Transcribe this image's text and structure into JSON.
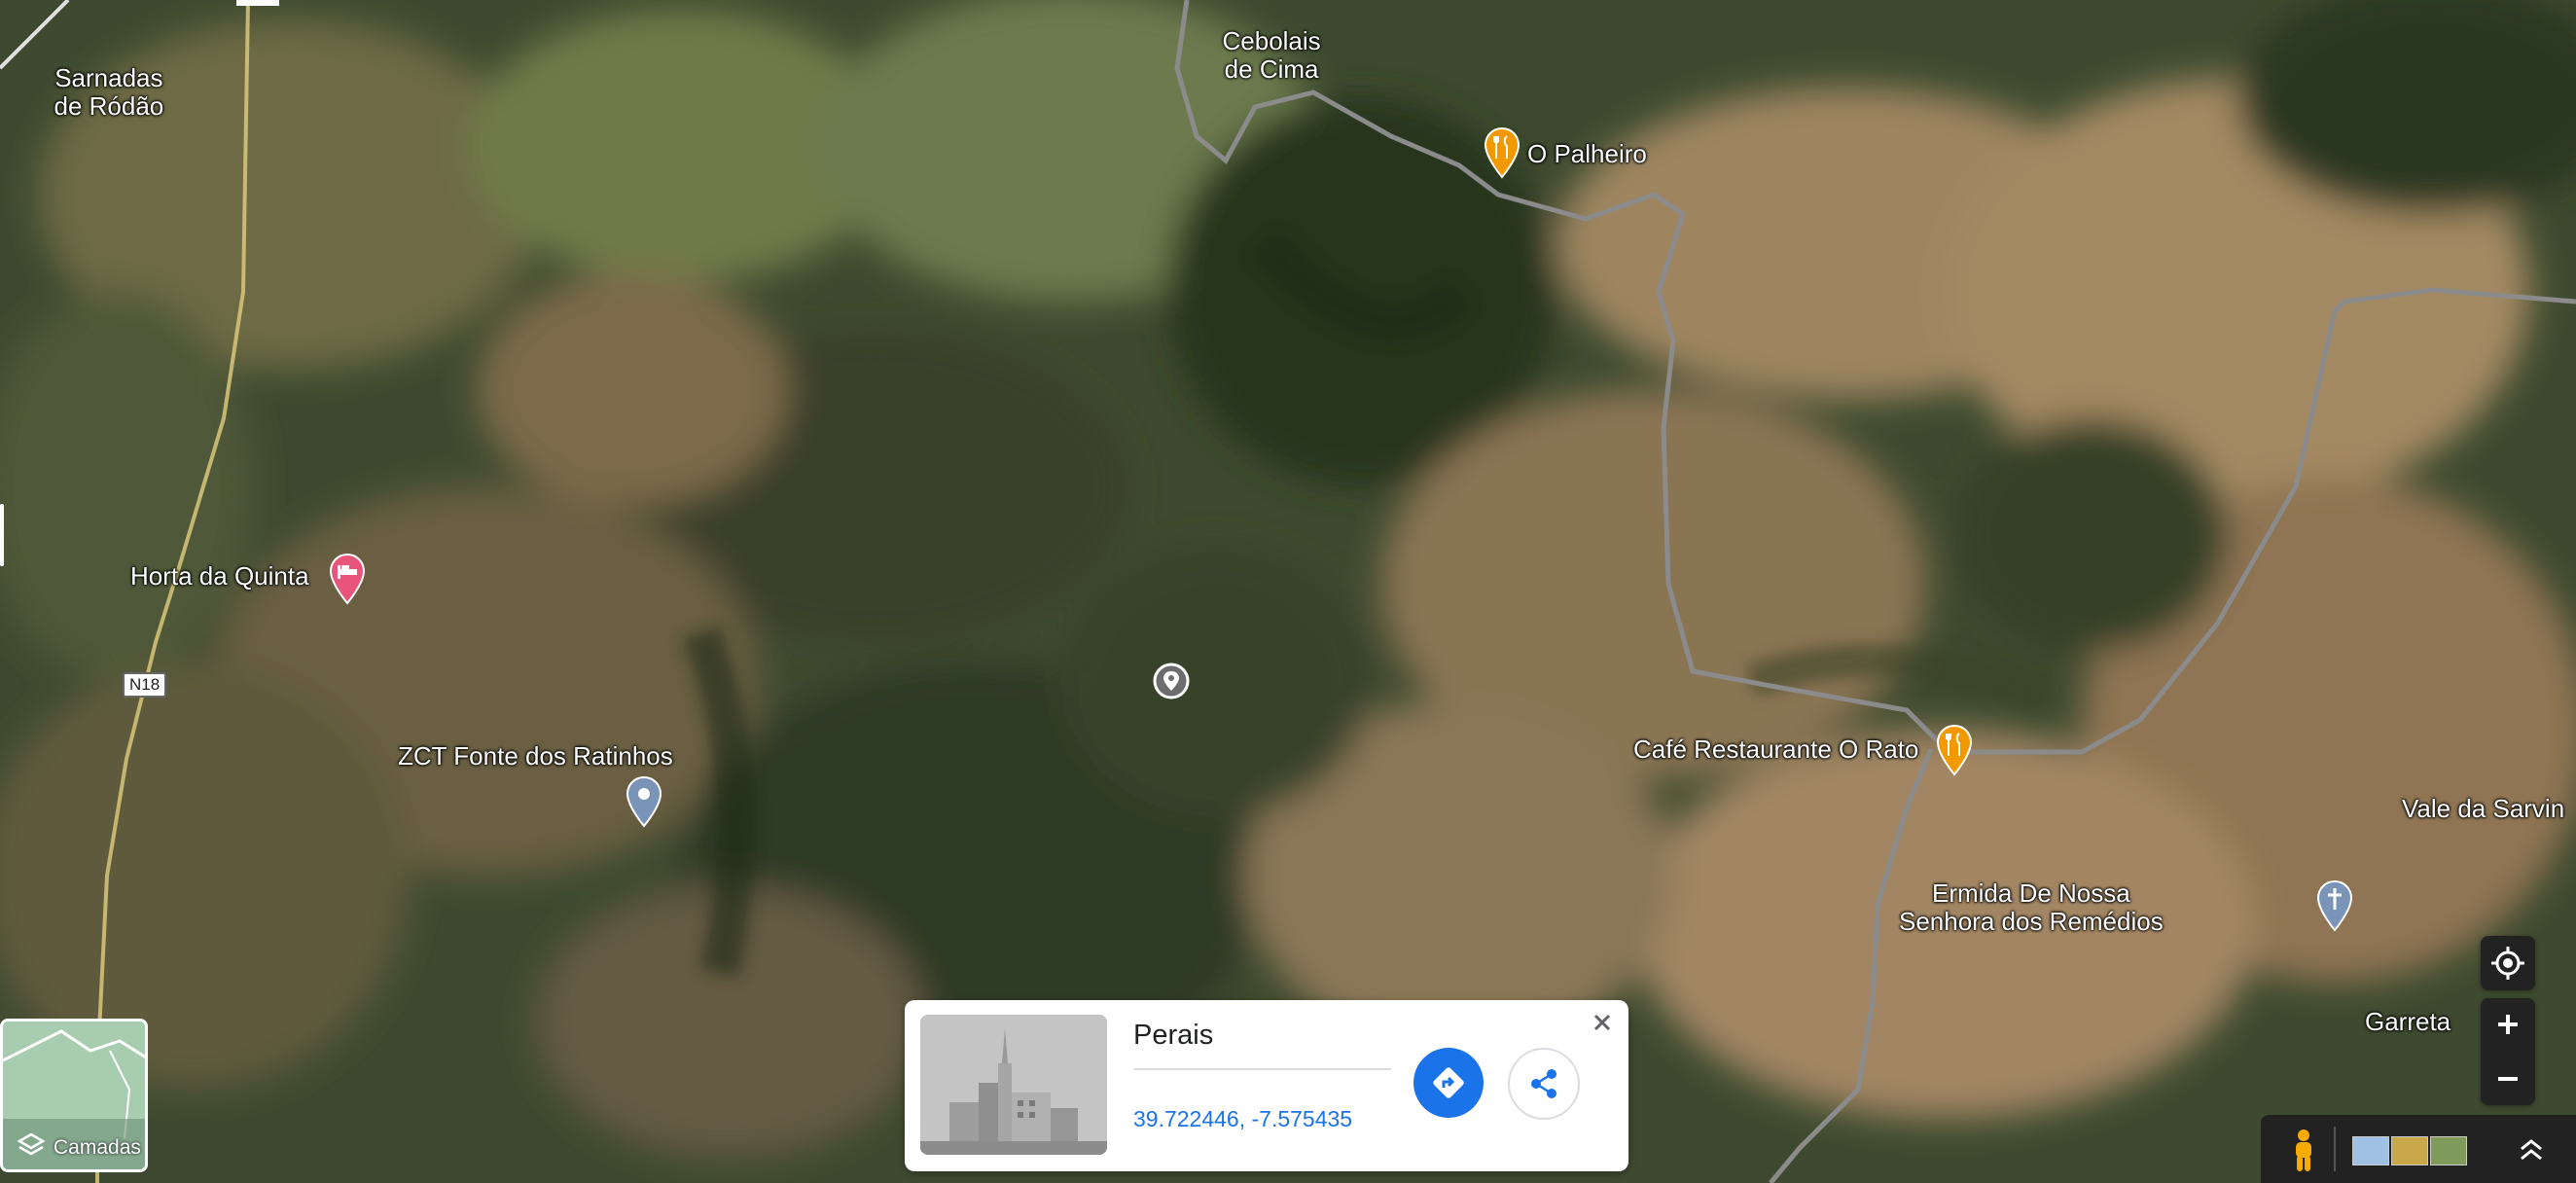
{
  "colors": {
    "accent": "#1a73e8",
    "restaurant_pin": "#f29900",
    "hotel_pin": "#e9547a",
    "place_pin": "#7a94b8"
  },
  "map": {
    "labels": [
      {
        "id": "sarnadas",
        "text": "Sarnadas\nde Ródão"
      },
      {
        "id": "cebolais",
        "text": "Cebolais\nde Cima"
      },
      {
        "id": "palheiro",
        "text": "O Palheiro"
      },
      {
        "id": "horta",
        "text": "Horta da Quinta"
      },
      {
        "id": "zct",
        "text": "ZCT Fonte dos Ratinhos"
      },
      {
        "id": "cafe",
        "text": "Café Restaurante O Rato"
      },
      {
        "id": "vale",
        "text": "Vale da Sarvin"
      },
      {
        "id": "ermida",
        "text": "Ermida De Nossa\nSenhora dos Remédios"
      },
      {
        "id": "garreta",
        "text": "Garreta"
      }
    ],
    "road_shield": "N18",
    "icons": {
      "restaurant": "fork-knife-icon",
      "hotel": "bed-icon",
      "place": "location-pin-icon",
      "church": "cross-icon",
      "dropped_pin": "dropped-pin-icon"
    }
  },
  "card": {
    "title": "Perais",
    "coords": "39.722446, -7.575435",
    "directions_icon": "directions-icon",
    "share_icon": "share-icon",
    "close_icon": "close-icon"
  },
  "layers": {
    "label": "Camadas",
    "icon": "layers-icon"
  },
  "controls": {
    "locate_icon": "my-location-icon",
    "zoom_in": "+",
    "zoom_out": "−",
    "pegman_icon": "pegman-icon",
    "expand_icon": "chevron-up-icon"
  }
}
